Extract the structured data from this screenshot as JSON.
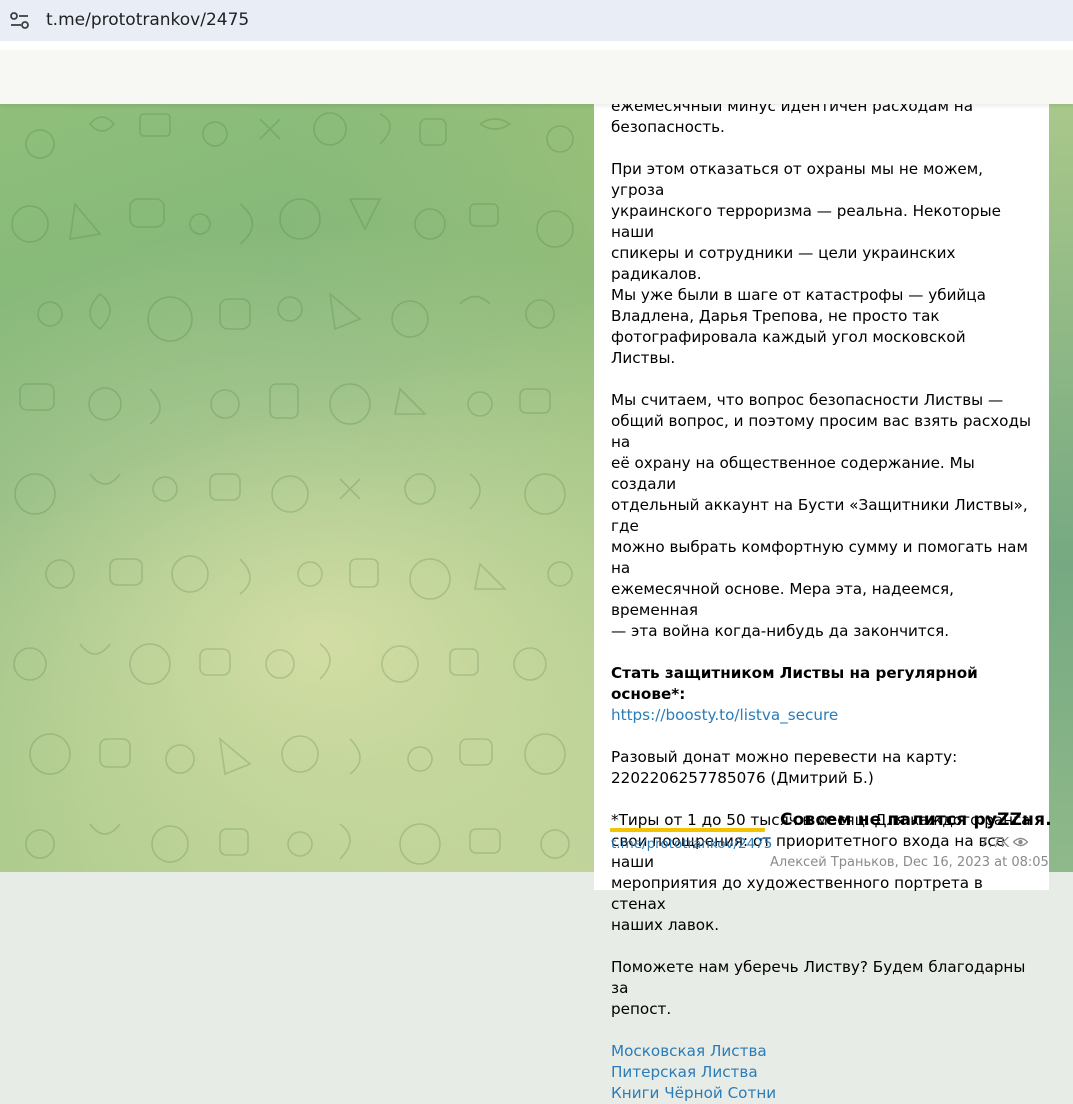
{
  "browser": {
    "url": "t.me/prototrankov/2475"
  },
  "post": {
    "paragraphs": [
      [
        "ежемесячный минус идентичен расходам на",
        "безопасность."
      ],
      [
        "При этом отказаться от охраны мы не можем, угроза",
        "украинского терроризма — реальна. Некоторые наши",
        "спикеры и сотрудники — цели украинских радикалов.",
        "Мы уже были в шаге от катастрофы — убийца",
        "Владлена, Дарья Трепова, не просто так",
        "фотографировала каждый угол московской Листвы."
      ],
      [
        "Мы считаем, что вопрос безопасности Листвы —",
        "общий вопрос, и поэтому просим вас взять расходы на",
        "её охрану на общественное содержание. Мы создали",
        "отдельный аккаунт на Бусти «Защитники Листвы», где",
        "можно выбрать комфортную сумму и помогать нам на",
        "ежемесячной основе. Мера эта, надеемся, временная",
        "— эта война когда-нибудь да закончится."
      ]
    ],
    "cta_bold": "Стать защитником Листвы на регулярной основе*:",
    "cta_link": "https://boosty.to/listva_secure",
    "donate_lines": [
      "Разовый донат можно перевести на карту:",
      "2202206257785076 (Дмитрий Б.)"
    ],
    "tiers_lines": [
      "*Тиры от 1 до 50 тысяч в месяц. Для каждого ранга",
      "свои поощрения: от приоритетного входа на все наши",
      "мероприятия до художественного портрета в стенах",
      "наших лавок."
    ],
    "repost_lines": [
      "Поможете нам уберечь Листву? Будем благодарны за",
      "репост."
    ],
    "tags": [
      "Московская Листва",
      "Питерская Листва",
      "Книги Чёрной Сотни"
    ],
    "channel_link": "t.me/prototrankov/2475",
    "views": "7.7K",
    "author_date": "Алексей Траньков, Dec 16, 2023 at 08:05"
  },
  "overlay": {
    "caption": "Совсем не палится руZZня."
  },
  "colors": {
    "link": "#2b7cb8",
    "highlight_underline": "#f2c400",
    "meta_gray": "#8a8a8a"
  }
}
